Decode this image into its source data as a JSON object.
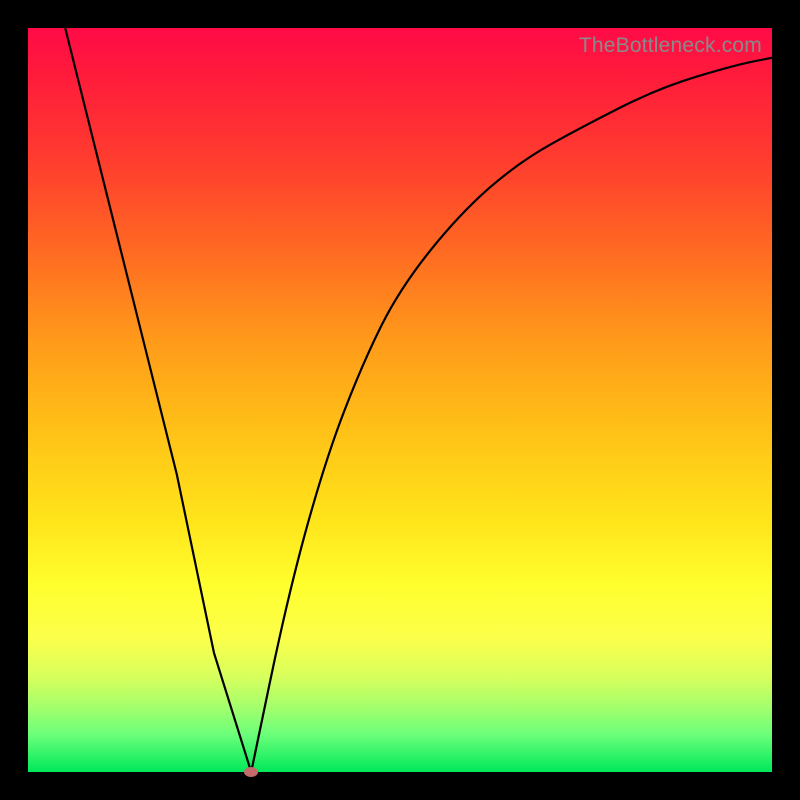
{
  "watermark": "TheBottleneck.com",
  "chart_data": {
    "type": "line",
    "title": "",
    "xlabel": "",
    "ylabel": "",
    "xlim": [
      0,
      100
    ],
    "ylim": [
      0,
      100
    ],
    "grid": false,
    "legend": false,
    "series": [
      {
        "name": "bottleneck-curve",
        "x": [
          5,
          8,
          12,
          16,
          20,
          25,
          30,
          35,
          40,
          45,
          50,
          58,
          66,
          75,
          85,
          95,
          100
        ],
        "values": [
          100,
          88,
          72,
          56,
          40,
          16,
          0,
          24,
          42,
          55,
          65,
          75,
          82,
          87,
          92,
          95,
          96
        ]
      }
    ],
    "marker": {
      "x": 30,
      "y": 0,
      "color": "#c46b6b"
    },
    "gradient_stops": [
      {
        "pos": 0,
        "color": "#ff0b47"
      },
      {
        "pos": 25,
        "color": "#ff7a20"
      },
      {
        "pos": 50,
        "color": "#ffd318"
      },
      {
        "pos": 75,
        "color": "#ffff2e"
      },
      {
        "pos": 100,
        "color": "#00e85a"
      }
    ]
  }
}
